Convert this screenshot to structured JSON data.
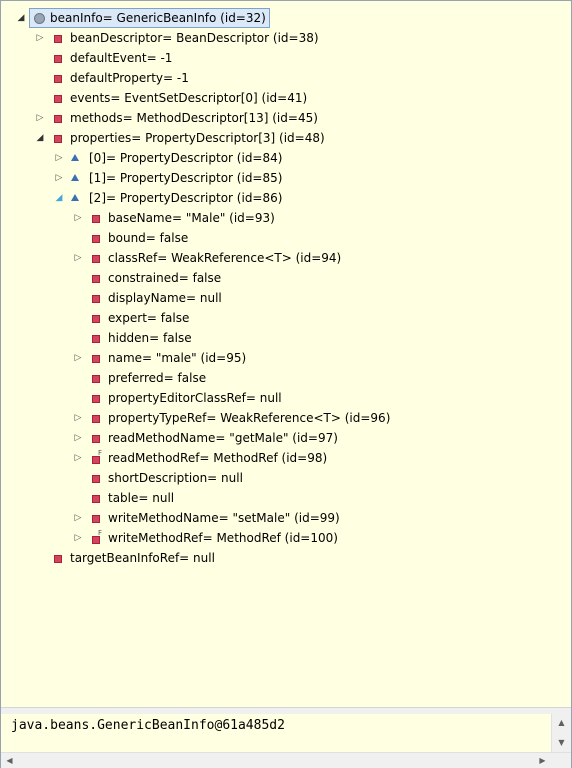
{
  "tree": {
    "root": {
      "label": "beanInfo= GenericBeanInfo  (id=32)"
    },
    "rows": [
      {
        "label": "beanDescriptor= BeanDescriptor  (id=38)"
      },
      {
        "label": "defaultEvent= -1"
      },
      {
        "label": "defaultProperty= -1"
      },
      {
        "label": "events= EventSetDescriptor[0]  (id=41)"
      },
      {
        "label": "methods= MethodDescriptor[13]  (id=45)"
      },
      {
        "label": "properties= PropertyDescriptor[3]  (id=48)"
      },
      {
        "label": "[0]= PropertyDescriptor  (id=84)"
      },
      {
        "label": "[1]= PropertyDescriptor  (id=85)"
      },
      {
        "label": "[2]= PropertyDescriptor  (id=86)"
      },
      {
        "label": "baseName= \"Male\" (id=93)"
      },
      {
        "label": "bound= false"
      },
      {
        "label": "classRef= WeakReference<T>  (id=94)"
      },
      {
        "label": "constrained= false"
      },
      {
        "label": "displayName= null"
      },
      {
        "label": "expert= false"
      },
      {
        "label": "hidden= false"
      },
      {
        "label": "name= \"male\" (id=95)"
      },
      {
        "label": "preferred= false"
      },
      {
        "label": "propertyEditorClassRef= null"
      },
      {
        "label": "propertyTypeRef= WeakReference<T>  (id=96)"
      },
      {
        "label": "readMethodName= \"getMale\" (id=97)"
      },
      {
        "label": "readMethodRef= MethodRef  (id=98)"
      },
      {
        "label": "shortDescription= null"
      },
      {
        "label": "table= null"
      },
      {
        "label": "writeMethodName= \"setMale\" (id=99)"
      },
      {
        "label": "writeMethodRef= MethodRef  (id=100)"
      },
      {
        "label": "targetBeanInfoRef= null"
      }
    ]
  },
  "detail": {
    "value": "java.beans.GenericBeanInfo@61a485d2"
  },
  "icons": {
    "twisty_collapsed": "▷",
    "twisty_expanded": "◢",
    "scroll_up": "▲",
    "scroll_down": "▼",
    "scroll_left": "◀",
    "scroll_right": "▶"
  },
  "colors": {
    "background": "#ffffe1",
    "field_icon": "#d2465d",
    "array_icon": "#3a6fb5",
    "selection": "#dbe8f8"
  }
}
